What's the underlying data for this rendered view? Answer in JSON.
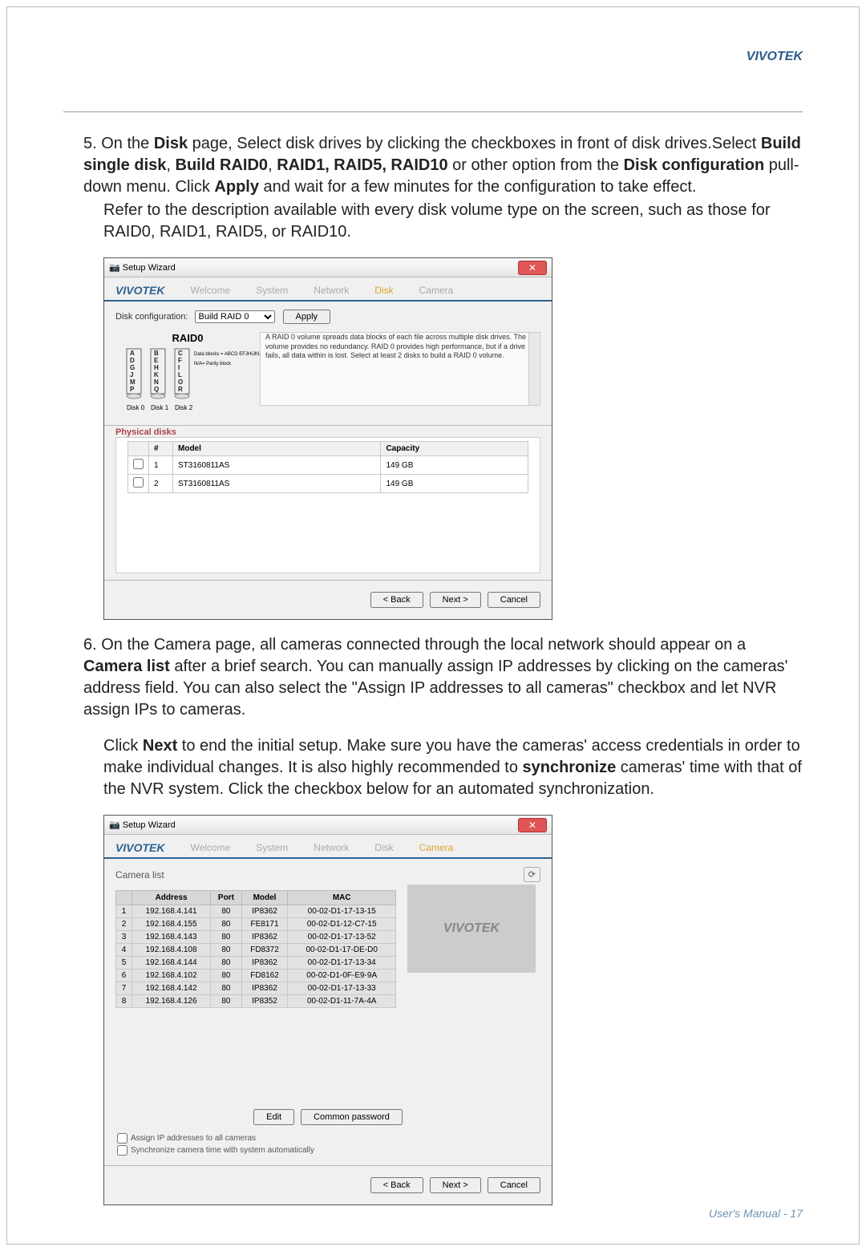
{
  "header": {
    "brand": "VIVOTEK"
  },
  "step5": {
    "prefix": "5. On the ",
    "disk": "Disk",
    "a": " page, Select disk drives by clicking the checkboxes in front of disk drives.Select ",
    "b": "Build single disk",
    "comma": ", ",
    "c": "Build RAID0",
    "d": "RAID1, RAID5, RAID10",
    "e": " or other option from the ",
    "f": "Disk configuration",
    "g": " pull-down menu. Click ",
    "h": "Apply",
    "i": " and wait for a few minutes for the configuration to take effect.",
    "refer": "Refer to the description available with every disk volume type on the screen, such as those for RAID0, RAID1, RAID5, or RAID10."
  },
  "step6": {
    "intro1_pre": "6. On the Camera page, all cameras connected through the local network should appear on a ",
    "bold1": "Camera list",
    "intro1_post": " after a brief search. You can manually assign IP addresses by clicking on the cameras' address field. You can also select the \"Assign IP addresses to all cameras\" checkbox and let NVR assign IPs to cameras.",
    "p2_pre": "Click ",
    "p2_b1": "Next",
    "p2_mid": " to end the initial setup. Make sure you have the cameras' access credentials in order to make individual changes. It is also highly recommended to ",
    "p2_b2": "synchronize",
    "p2_post": " cameras' time with that of the NVR system. Click the checkbox below for an automated synchronization."
  },
  "dlg1": {
    "title": "Setup Wizard",
    "logo": "VIVOTEK",
    "tabs": {
      "welcome": "Welcome",
      "system": "System",
      "network": "Network",
      "disk": "Disk",
      "camera": "Camera"
    },
    "cfg_label": "Disk configuration:",
    "cfg_value": "Build RAID 0",
    "apply": "Apply",
    "raid_title": "RAID0",
    "legend1": "Data blocks = ABCD EFJHIJKLMNOPQR",
    "legend2": "N/A= Parity block",
    "disks": {
      "d0": "Disk 0",
      "d1": "Disk 1",
      "d2": "Disk 2"
    },
    "desc": "A RAID 0 volume spreads data blocks of each file across multiple disk drives. The volume provides no redundancy. RAID 0 provides high performance, but if a drive fails, all data within is lost. Select at least 2 disks to build a RAID 0 volume.",
    "phys_title": "Physical disks",
    "th": {
      "num": "#",
      "model": "Model",
      "cap": "Capacity"
    },
    "rows": [
      {
        "n": "1",
        "model": "ST3160811AS",
        "cap": "149 GB"
      },
      {
        "n": "2",
        "model": "ST3160811AS",
        "cap": "149 GB"
      }
    ],
    "back": "< Back",
    "next": "Next >",
    "cancel": "Cancel"
  },
  "dlg2": {
    "title": "Setup Wizard",
    "logo": "VIVOTEK",
    "tabs": {
      "welcome": "Welcome",
      "system": "System",
      "network": "Network",
      "disk": "Disk",
      "camera": "Camera"
    },
    "list_label": "Camera list",
    "preview": "VIVOTEK",
    "th": {
      "addr": "Address",
      "port": "Port",
      "model": "Model",
      "mac": "MAC"
    },
    "rows": [
      {
        "n": "1",
        "addr": "192.168.4.141",
        "port": "80",
        "model": "IP8362",
        "mac": "00-02-D1-17-13-15"
      },
      {
        "n": "2",
        "addr": "192.168.4.155",
        "port": "80",
        "model": "FE8171",
        "mac": "00-02-D1-12-C7-15"
      },
      {
        "n": "3",
        "addr": "192.168.4.143",
        "port": "80",
        "model": "IP8362",
        "mac": "00-02-D1-17-13-52"
      },
      {
        "n": "4",
        "addr": "192.168.4.108",
        "port": "80",
        "model": "FD8372",
        "mac": "00-02-D1-17-DE-D0"
      },
      {
        "n": "5",
        "addr": "192.168.4.144",
        "port": "80",
        "model": "IP8362",
        "mac": "00-02-D1-17-13-34"
      },
      {
        "n": "6",
        "addr": "192.168.4.102",
        "port": "80",
        "model": "FD8162",
        "mac": "00-02-D1-0F-E9-9A"
      },
      {
        "n": "7",
        "addr": "192.168.4.142",
        "port": "80",
        "model": "IP8362",
        "mac": "00-02-D1-17-13-33"
      },
      {
        "n": "8",
        "addr": "192.168.4.126",
        "port": "80",
        "model": "IP8352",
        "mac": "00-02-D1-11-7A-4A"
      }
    ],
    "edit": "Edit",
    "common": "Common password",
    "chk1": "Assign IP addresses to all cameras",
    "chk2": "Synchronize camera time with system automatically",
    "back": "< Back",
    "next": "Next >",
    "cancel": "Cancel"
  },
  "footer": "User's Manual - 17"
}
